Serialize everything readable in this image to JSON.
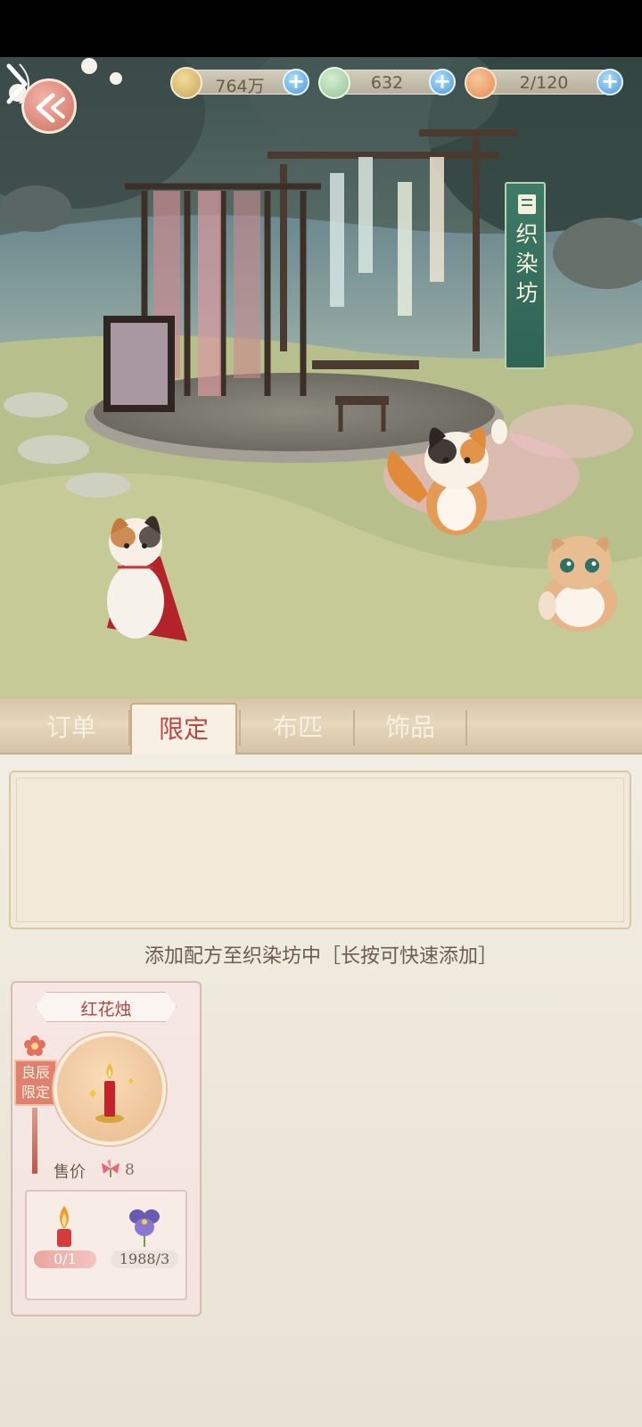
{
  "resources": [
    {
      "name": "paw-coin",
      "value": "764万",
      "color": "#c8a55a"
    },
    {
      "name": "jade",
      "value": "632",
      "color": "#8fc39a"
    },
    {
      "name": "stamina",
      "value": "2/120",
      "color": "#e58a54"
    }
  ],
  "workshop": {
    "title_chars": [
      "织",
      "染",
      "坊"
    ]
  },
  "tabs": [
    {
      "label": "订单"
    },
    {
      "label": "限定"
    },
    {
      "label": "布匹"
    },
    {
      "label": "饰品"
    }
  ],
  "active_tab": "限定",
  "hint": "添加配方至织染坊中［长按可快速添加］",
  "recipe": {
    "name": "红花烛",
    "badge_lines": [
      "良辰",
      "限定"
    ],
    "price_label": "售价",
    "price_value": "8",
    "materials": [
      {
        "icon": "candle-icon",
        "count": "0/1"
      },
      {
        "icon": "violet-flower-icon",
        "count": "1988/3"
      }
    ]
  }
}
